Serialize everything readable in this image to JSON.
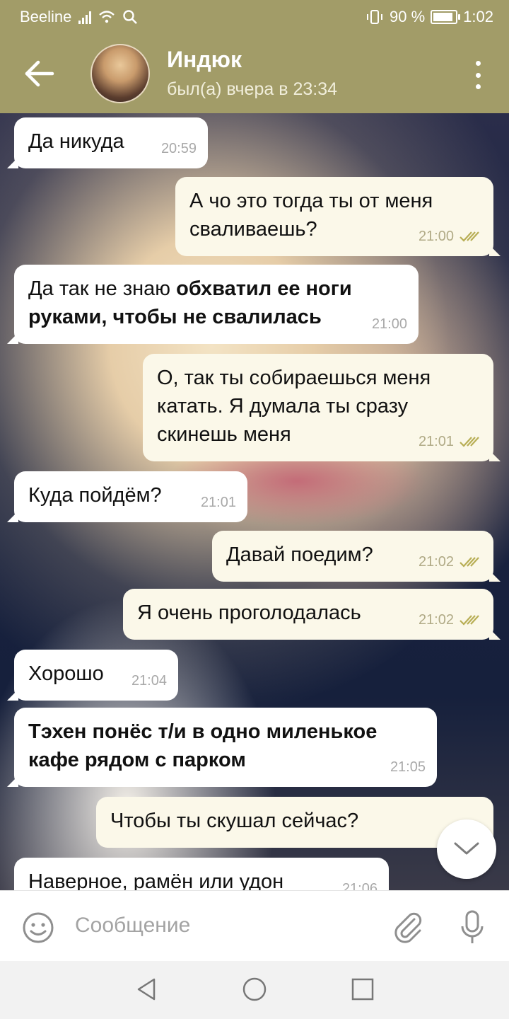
{
  "status_bar": {
    "carrier": "Beeline",
    "battery_percent": "90 %",
    "battery_level": 0.9,
    "time": "1:02"
  },
  "header": {
    "contact_name": "Индюк",
    "last_seen": "был(а) вчера в 23:34"
  },
  "messages": [
    {
      "direction": "in",
      "text": "Да никуда",
      "time": "20:59"
    },
    {
      "direction": "out",
      "text": "А чо это тогда ты от меня сваливаешь?",
      "time": "21:00",
      "read": true
    },
    {
      "direction": "in",
      "text_plain": "Да так не знаю ",
      "text_bold": "обхватил ее ноги руками, чтобы не свалилась",
      "time": "21:00"
    },
    {
      "direction": "out",
      "text": "О, так ты собираешься меня катать. Я думала ты сразу скинешь меня",
      "time": "21:01",
      "read": true
    },
    {
      "direction": "in",
      "text": "Куда пойдём?",
      "time": "21:01"
    },
    {
      "direction": "out",
      "text": "Давай поедим?",
      "time": "21:02",
      "read": true
    },
    {
      "direction": "out",
      "text": "Я очень проголодалась",
      "time": "21:02",
      "read": true
    },
    {
      "direction": "in",
      "text": "Хорошо",
      "time": "21:04"
    },
    {
      "direction": "in",
      "text_bold": "Тэхен понёс т/и в одно миленькое кафе рядом с парком",
      "time": "21:05"
    },
    {
      "direction": "out",
      "text": "Чтобы ты скушал сейчас?",
      "time": "21:0"
    },
    {
      "direction": "in",
      "text": "Наверное, рамён или удон",
      "time": "21:06"
    }
  ],
  "input": {
    "placeholder": "Сообщение"
  },
  "icons": {
    "back": "arrow-left-icon",
    "menu": "more-vert-icon",
    "emoji": "emoji-icon",
    "attach": "paperclip-icon",
    "mic": "mic-icon",
    "scroll": "chevron-down-icon",
    "nav_back": "triangle-back-icon",
    "nav_home": "circle-home-icon",
    "nav_recents": "square-recents-icon"
  },
  "colors": {
    "header": "#a29c68",
    "incoming_bubble": "#ffffff",
    "outgoing_bubble": "#fbf8e9",
    "read_check": "#b8ae55"
  }
}
